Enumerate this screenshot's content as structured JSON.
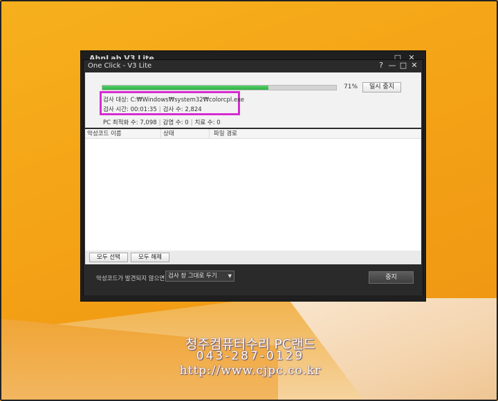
{
  "back_window": {
    "title": "AhnLab V3 Lite",
    "controls": [
      "□",
      "✕"
    ]
  },
  "window": {
    "title": "One Click - V3 Lite",
    "controls": {
      "help": "?",
      "minimize": "—",
      "maximize": "□",
      "close": "✕"
    }
  },
  "scan": {
    "progress": 0.71,
    "progress_label": "71%",
    "pause_label": "일시 중지",
    "target_label": "검사 대상:",
    "target_value": "C:₩Windows₩system32₩colorcpl.exe",
    "time_label": "검사 시간:",
    "time_value": "00:01:35",
    "count_label": "검사 수:",
    "count_value": "2,824",
    "pc_opt_label": "PC 최적화 수:",
    "pc_opt_value": "7,098",
    "infected_label": "감염 수:",
    "infected_value": "0",
    "treated_label": "치료 수:",
    "treated_value": "0"
  },
  "list": {
    "columns": [
      "악성코드 이름",
      "상태",
      "파일 경로"
    ],
    "rows": []
  },
  "buttons": {
    "select_all": "모두 선택",
    "deselect_all": "모두 해제"
  },
  "footer": {
    "label": "악성코드가 발견되지 않으면",
    "option_selected": "검사 창 그대로 두기",
    "stop_label": "중지"
  },
  "watermark": {
    "line1": "청주컴퓨터수리 PC랜드",
    "line2": "043-287-0129",
    "line3": "http://www.cjpc.co.kr"
  },
  "colors": {
    "progress_green": "#2eb248",
    "highlight_magenta": "#d52bd1",
    "window_dark": "#2a2a2a",
    "desktop_orange": "#f4a216"
  },
  "icons": {
    "help": "question-icon",
    "minimize": "minimize-icon",
    "maximize": "maximize-icon",
    "close": "close-icon",
    "dropdown": "chevron-down-icon"
  }
}
